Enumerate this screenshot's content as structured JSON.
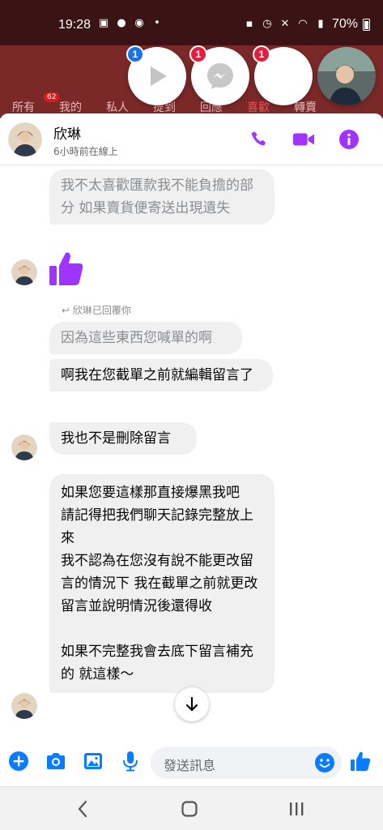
{
  "status_bar": {
    "time": "19:28",
    "battery": "70%",
    "network": "Vo)) LTE1"
  },
  "background_app": {
    "tabs": [
      "所有",
      "我的",
      "私人",
      "提到",
      "回應",
      "喜歡",
      "轉賣"
    ],
    "active_tab": "喜歡",
    "badge": "62"
  },
  "chat_heads": [
    {
      "icon": "play-icon",
      "count": "1",
      "badge_color": "#1a73e8"
    },
    {
      "icon": "messenger-icon",
      "count": "1",
      "badge_color": "#e41e3f"
    },
    {
      "icon": "blank-icon",
      "count": "1",
      "badge_color": "#e41e3f"
    },
    {
      "icon": "profile-photo",
      "count": ""
    }
  ],
  "header": {
    "name": "欣琳",
    "presence": "6小時前在線上",
    "accent": "#a033ff"
  },
  "messages": [
    {
      "id": "m1",
      "text": "我不太喜歡匯款我不能負擔的部分 如果賣貨便寄送出現遺失",
      "faded": true
    },
    {
      "id": "like",
      "type": "like"
    },
    {
      "id": "reply_note",
      "text": "欣琳已回覆你"
    },
    {
      "id": "m2",
      "text": "因為這些東西您喊單的啊",
      "faded": true
    },
    {
      "id": "m3",
      "text": "啊我在您截單之前就編輯留言了"
    },
    {
      "id": "m4",
      "text": "我也不是刪除留言"
    },
    {
      "id": "m5",
      "text": "如果您要這樣那直接爆黑我吧\n請記得把我們聊天記錄完整放上來\n我不認為在您沒有說不能更改留言的情況下 我在截單之前就更改留言並說明情況後還得收\n\n如果不完整我會去底下留言補充的 就這樣～"
    }
  ],
  "composer": {
    "placeholder": "發送訊息",
    "accent": "#0a7cff"
  },
  "navbar": {
    "icons": [
      "back-icon",
      "home-icon",
      "recents-icon"
    ]
  }
}
